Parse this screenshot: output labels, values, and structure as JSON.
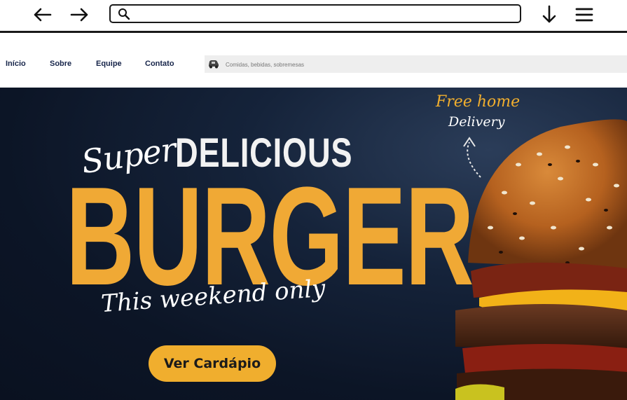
{
  "browser": {
    "back_icon": "arrow-left-icon",
    "forward_icon": "arrow-right-icon",
    "address_value": "",
    "search_icon": "search-icon",
    "download_icon": "arrow-down-icon",
    "menu_icon": "hamburger-menu-icon"
  },
  "nav": {
    "links": [
      "Início",
      "Sobre",
      "Equipe",
      "Contato"
    ],
    "search_placeholder": "Comidas, bebidas, sobremesas",
    "search_icon": "delivery-car-icon"
  },
  "hero": {
    "script_word": "Super",
    "headline": "DELICIOUS",
    "big_word": "BURGER",
    "tagline": "This weekend only",
    "cta_label": "Ver Cardápio",
    "badge_line1": "Free home",
    "badge_line2": "Delivery",
    "colors": {
      "accent": "#f0ae2e",
      "background": "#0e1a2e",
      "nav_text": "#17254a"
    }
  }
}
